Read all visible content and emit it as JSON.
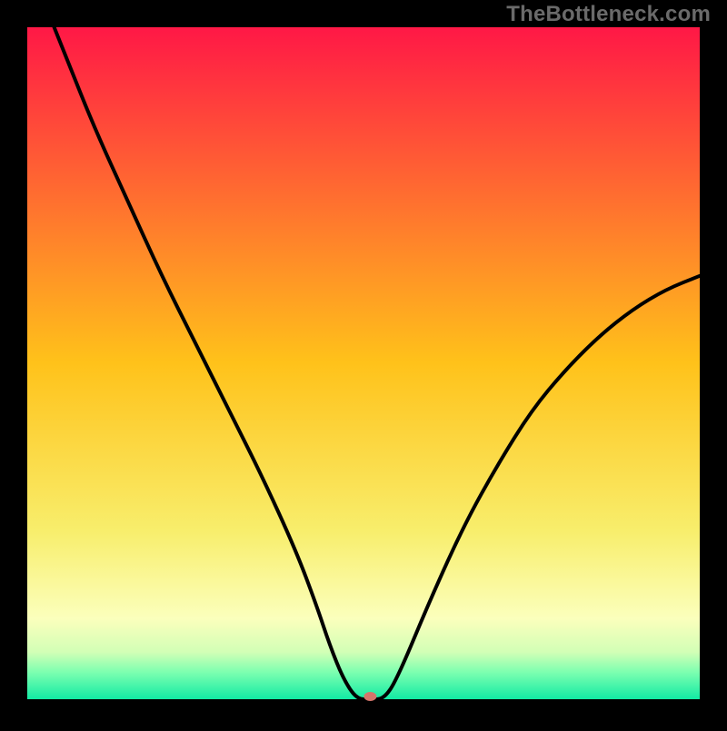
{
  "watermark": "TheBottleneck.com",
  "chart_data": {
    "type": "line",
    "title": "",
    "xlabel": "",
    "ylabel": "",
    "xlim": [
      0,
      100
    ],
    "ylim": [
      0,
      100
    ],
    "grid": false,
    "legend": null,
    "background_gradient": {
      "stops": [
        {
          "offset": 0.0,
          "color": "#ff1846"
        },
        {
          "offset": 0.5,
          "color": "#ffc21a"
        },
        {
          "offset": 0.75,
          "color": "#f8ee6c"
        },
        {
          "offset": 0.88,
          "color": "#fbffbc"
        },
        {
          "offset": 0.93,
          "color": "#d2ffb6"
        },
        {
          "offset": 0.96,
          "color": "#7cffb0"
        },
        {
          "offset": 1.0,
          "color": "#12eaa4"
        }
      ]
    },
    "series": [
      {
        "name": "bottleneck-curve",
        "color": "#000000",
        "x": [
          4,
          6,
          10,
          15,
          20,
          25,
          30,
          35,
          40,
          43,
          45,
          47,
          49,
          51,
          53,
          55,
          60,
          65,
          70,
          75,
          80,
          85,
          90,
          95,
          100
        ],
        "y": [
          100,
          95,
          85,
          74,
          63,
          53,
          43,
          33,
          22,
          14,
          8,
          3,
          0,
          0,
          0,
          3,
          15,
          26,
          35,
          43,
          49,
          54,
          58,
          61,
          63
        ]
      }
    ],
    "marker": {
      "name": "optimum-marker",
      "x": 51,
      "y": 0,
      "color": "#d4756b",
      "rx": 7,
      "ry": 5
    }
  }
}
